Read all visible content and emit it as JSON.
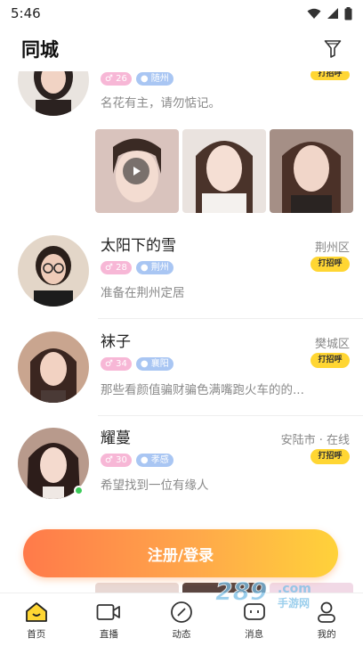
{
  "status_bar": {
    "time": "5:46"
  },
  "header": {
    "title": "同城"
  },
  "users": [
    {
      "name": "",
      "age": "26",
      "city": "随州",
      "bio": "名花有主，请勿惦记。",
      "location": "",
      "greet": "打招呼"
    },
    {
      "name": "太阳下的雪",
      "age": "28",
      "city": "荆州",
      "bio": "准备在荆州定居",
      "location": "荆州区",
      "greet": "打招呼"
    },
    {
      "name": "袜子",
      "age": "34",
      "city": "襄阳",
      "bio": "那些看颜值骗财骗色满嘴跑火车的的...",
      "location": "樊城区",
      "greet": "打招呼"
    },
    {
      "name": "耀蔓",
      "age": "30",
      "city": "孝感",
      "bio": "希望找到一位有缘人",
      "location": "安陆市 · 在线",
      "greet": "打招呼"
    }
  ],
  "login_button": {
    "label": "注册/登录"
  },
  "tabs": [
    {
      "label": "首页",
      "icon": "home-icon"
    },
    {
      "label": "直播",
      "icon": "video-icon"
    },
    {
      "label": "动态",
      "icon": "compass-icon"
    },
    {
      "label": "消息",
      "icon": "message-icon"
    },
    {
      "label": "我的",
      "icon": "profile-icon"
    }
  ],
  "watermark": {
    "text_big": "289",
    "text_sub": ".com",
    "text_cn": "手游网"
  },
  "colors": {
    "accent": "#ffd633",
    "login_gradient_start": "#ff7a4a",
    "login_gradient_end": "#ffd23a",
    "tag_age": "#f7b7d6",
    "tag_city": "#a9c6f3",
    "online": "#3ccb5a"
  }
}
